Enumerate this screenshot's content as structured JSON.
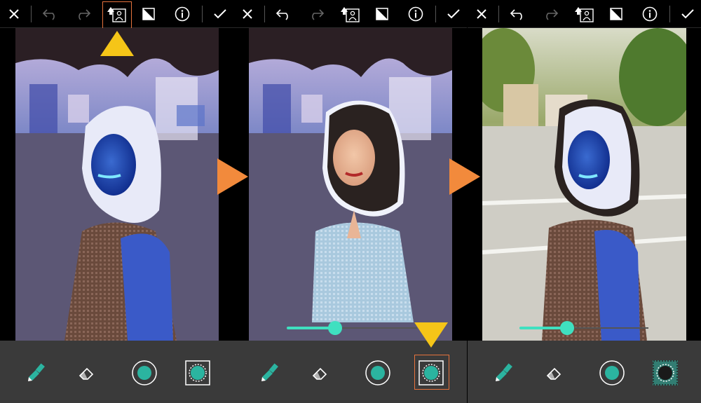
{
  "screens": [
    {
      "id": "screen-1",
      "highlight": "restore-button",
      "slider_visible": false
    },
    {
      "id": "screen-2",
      "highlight": "outline-button",
      "slider_visible": true,
      "slider_value": 0.37
    },
    {
      "id": "screen-3",
      "highlight": "",
      "slider_visible": true,
      "slider_value": 0.37,
      "outline_active": true
    }
  ],
  "toolbar_icons": [
    "close-icon",
    "undo-icon",
    "redo-icon",
    "person-restore-icon",
    "eraser-page-icon",
    "info-icon",
    "checkmark-icon"
  ],
  "bottom_tools": [
    "brush-icon",
    "eraser-icon",
    "filled-circle-icon",
    "dotted-circle-icon"
  ],
  "colors": {
    "accent": "#3fe0c0",
    "highlight_box": "#e6733d",
    "pointer_yellow": "#f5c518",
    "arrow_orange": "#f28a3c",
    "toolbar_bg": "#000000",
    "bottombar_bg": "#3a3a3a"
  }
}
